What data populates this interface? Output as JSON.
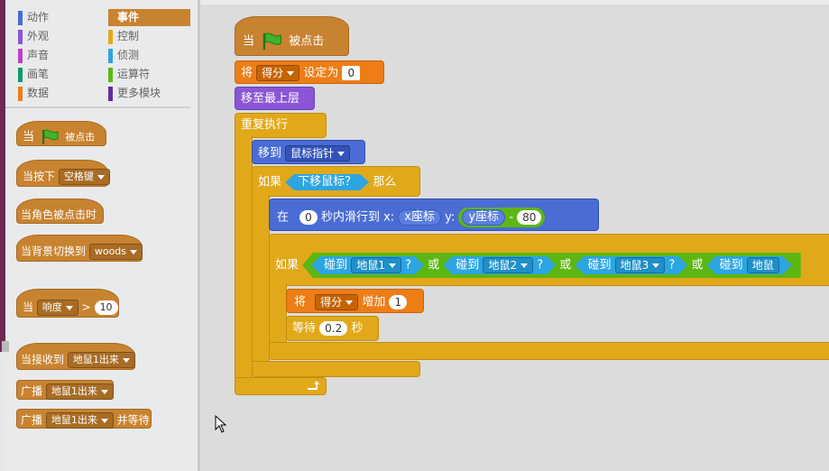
{
  "categories": [
    {
      "label": "动作",
      "color": "#4a6cd4"
    },
    {
      "label": "事件",
      "color": "#c88330",
      "active": true
    },
    {
      "label": "外观",
      "color": "#8a55d7"
    },
    {
      "label": "控制",
      "color": "#e1a91a"
    },
    {
      "label": "声音",
      "color": "#bb42c3"
    },
    {
      "label": "侦测",
      "color": "#2ca5e2"
    },
    {
      "label": "画笔",
      "color": "#0e9a6c"
    },
    {
      "label": "运算符",
      "color": "#5cb712"
    },
    {
      "label": "数据",
      "color": "#ee7d16"
    },
    {
      "label": "更多模块",
      "color": "#632d99"
    }
  ],
  "palette": {
    "when_flag": {
      "pre": "当",
      "post": "被点击"
    },
    "when_key": {
      "pre": "当按下",
      "key": "空格键"
    },
    "when_sprite_clicked": "当角色被点击时",
    "when_backdrop": {
      "pre": "当背景切换到",
      "value": "woods"
    },
    "when_sensor": {
      "pre": "当",
      "sensor": "响度",
      "op": ">",
      "value": "10"
    },
    "when_receive": {
      "pre": "当接收到",
      "msg": "地鼠1出来"
    },
    "broadcast": {
      "pre": "广播",
      "msg": "地鼠1出来"
    },
    "broadcast_wait": {
      "pre": "广播",
      "msg": "地鼠1出来",
      "post": "并等待"
    }
  },
  "script": {
    "hat": {
      "pre": "当",
      "post": "被点击"
    },
    "set_var": {
      "pre": "将",
      "var": "得分",
      "mid": "设定为",
      "value": "0"
    },
    "front": "移至最上层",
    "forever": "重复执行",
    "goto": {
      "pre": "移到",
      "target": "鼠标指针"
    },
    "if1": {
      "pre": "如果",
      "cond": "下移鼠标？",
      "post": "那么"
    },
    "glide": {
      "pre": "在",
      "secs": "0",
      "mid": "秒内滑行到 x:",
      "x": "x座标",
      "ylabel": "y:",
      "y": "y座标",
      "minus": "-",
      "offset": "80"
    },
    "if2": {
      "pre": "如果",
      "touch": "碰到",
      "q": "?",
      "or": "或",
      "targets": [
        "地鼠1",
        "地鼠2",
        "地鼠3",
        "地鼠"
      ]
    },
    "change": {
      "pre": "将",
      "var": "得分",
      "mid": "增加",
      "value": "1"
    },
    "wait": {
      "pre": "等待",
      "value": "0.2",
      "post": "秒"
    }
  }
}
